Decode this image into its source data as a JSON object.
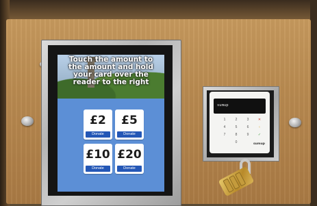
{
  "kiosk": {
    "prompt": "Touch the amount you would like to donate then touch the amount and hold your card over the reader to the right",
    "visible_prompt_lines": [
      "Touch the amount to",
      "the amount and hold",
      "your card over the",
      "reader to the right"
    ],
    "options": [
      {
        "amount": "£2",
        "action": "Donate"
      },
      {
        "amount": "£5",
        "action": "Donate"
      },
      {
        "amount": "£10",
        "action": "Donate"
      },
      {
        "amount": "£20",
        "action": "Donate"
      }
    ]
  },
  "card_reader": {
    "display_text": "sumup",
    "keys": [
      "1",
      "2",
      "3",
      "4",
      "5",
      "6",
      "7",
      "8",
      "9",
      "0"
    ],
    "brand": "sumup"
  },
  "colors": {
    "screen_bg": "#5c8fd6",
    "donate_button": "#2457b6",
    "wood": "#b98a50"
  }
}
